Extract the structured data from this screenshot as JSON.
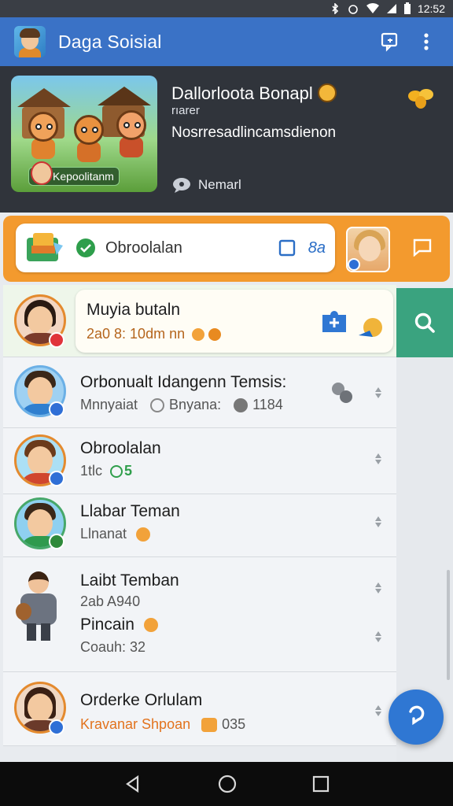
{
  "status": {
    "time": "12:52"
  },
  "appbar": {
    "title": "Daga Soisial"
  },
  "featured": {
    "title": "Dallorloota Bonapl",
    "subtitle": "rıarer",
    "description": "Nosrresadlincamsdienon",
    "meta": "Nemarl",
    "image_caption": "Kepoolitanm"
  },
  "action": {
    "label": "Obroolalan",
    "value": "8a"
  },
  "highlight": {
    "name": "Muyia butaln",
    "sub": "2a0 8:  10dm nn"
  },
  "list": [
    {
      "name": "Orbonualt Idangenn Temsis:",
      "sub1": "Mnnyaiat",
      "sub2": "Bnyana:",
      "sub3": "1184"
    },
    {
      "name": "Obroolalan",
      "sub1": "1tlc",
      "badge": "5"
    },
    {
      "name": "Llabar Teman",
      "sub1": "Llnanat"
    },
    {
      "name": "Laibt Temban",
      "sub1": "2ab A940",
      "name2": "Pincain",
      "sub2": "Coauh: 32"
    },
    {
      "name": "Orderke Orlulam",
      "sub1": "Kravanar Shpoan",
      "sub2": "035"
    }
  ],
  "colors": {
    "accent": "#3a72c6",
    "orange": "#f39a2e",
    "green": "#3aa37f"
  }
}
